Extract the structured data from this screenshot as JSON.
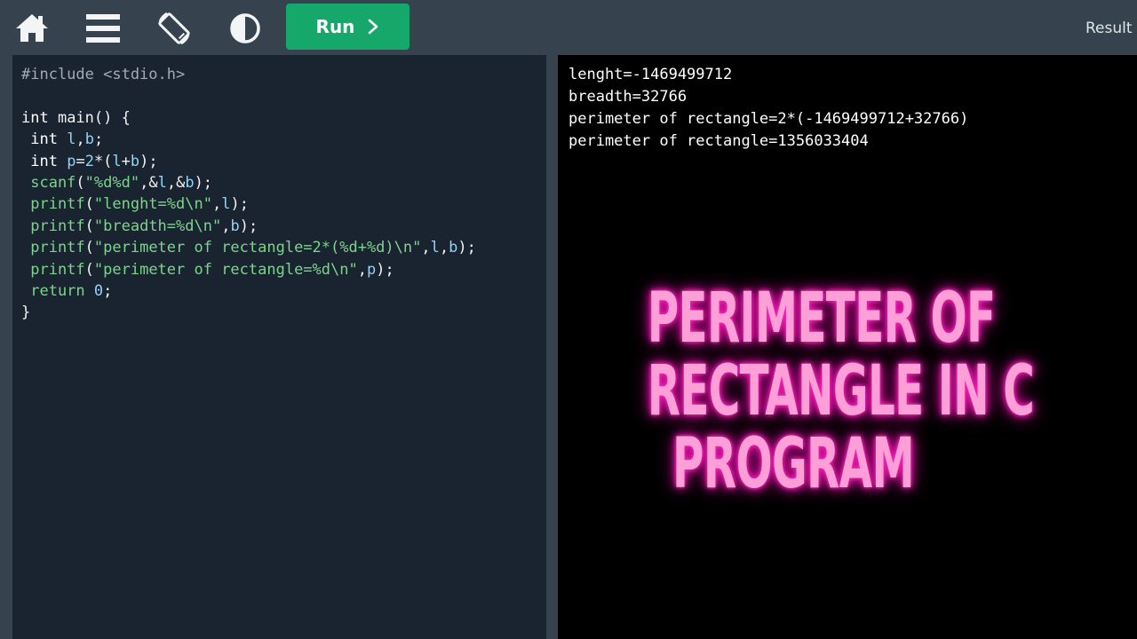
{
  "toolbar": {
    "icons": [
      "home-icon",
      "menu-icon",
      "rotate-screen-icon",
      "contrast-icon"
    ],
    "run_label": "Run",
    "result_label": "Result"
  },
  "editor": {
    "lines": [
      [
        {
          "t": "#include <stdio.h>",
          "c": "c-pre"
        }
      ],
      [],
      [
        {
          "t": "int ",
          "c": "c-kw"
        },
        {
          "t": "main() {",
          "c": "c-pl"
        }
      ],
      [
        {
          "t": " int ",
          "c": "c-kw"
        },
        {
          "t": "l",
          "c": "c-var"
        },
        {
          "t": ",",
          "c": "c-pl"
        },
        {
          "t": "b",
          "c": "c-var"
        },
        {
          "t": ";",
          "c": "c-pl"
        }
      ],
      [
        {
          "t": " int ",
          "c": "c-kw"
        },
        {
          "t": "p",
          "c": "c-var"
        },
        {
          "t": "=",
          "c": "c-pl"
        },
        {
          "t": "2",
          "c": "c-num"
        },
        {
          "t": "*(",
          "c": "c-pl"
        },
        {
          "t": "l",
          "c": "c-var"
        },
        {
          "t": "+",
          "c": "c-pl"
        },
        {
          "t": "b",
          "c": "c-var"
        },
        {
          "t": ");",
          "c": "c-pl"
        }
      ],
      [
        {
          "t": " scanf",
          "c": "c-fn"
        },
        {
          "t": "(",
          "c": "c-pl"
        },
        {
          "t": "\"%d%d\"",
          "c": "c-str"
        },
        {
          "t": ",&",
          "c": "c-pl"
        },
        {
          "t": "l",
          "c": "c-var"
        },
        {
          "t": ",&",
          "c": "c-pl"
        },
        {
          "t": "b",
          "c": "c-var"
        },
        {
          "t": ");",
          "c": "c-pl"
        }
      ],
      [
        {
          "t": " printf",
          "c": "c-fn"
        },
        {
          "t": "(",
          "c": "c-pl"
        },
        {
          "t": "\"lenght=%d\\n\"",
          "c": "c-str"
        },
        {
          "t": ",",
          "c": "c-pl"
        },
        {
          "t": "l",
          "c": "c-var"
        },
        {
          "t": ");",
          "c": "c-pl"
        }
      ],
      [
        {
          "t": " printf",
          "c": "c-fn"
        },
        {
          "t": "(",
          "c": "c-pl"
        },
        {
          "t": "\"breadth=%d\\n\"",
          "c": "c-str"
        },
        {
          "t": ",",
          "c": "c-pl"
        },
        {
          "t": "b",
          "c": "c-var"
        },
        {
          "t": ");",
          "c": "c-pl"
        }
      ],
      [
        {
          "t": " printf",
          "c": "c-fn"
        },
        {
          "t": "(",
          "c": "c-pl"
        },
        {
          "t": "\"perimeter of rectangle=2*(%d+%d)\\n\"",
          "c": "c-str"
        },
        {
          "t": ",",
          "c": "c-pl"
        },
        {
          "t": "l",
          "c": "c-var"
        },
        {
          "t": ",",
          "c": "c-pl"
        },
        {
          "t": "b",
          "c": "c-var"
        },
        {
          "t": ");",
          "c": "c-pl"
        }
      ],
      [
        {
          "t": " printf",
          "c": "c-fn"
        },
        {
          "t": "(",
          "c": "c-pl"
        },
        {
          "t": "\"perimeter of rectangle=%d\\n\"",
          "c": "c-str"
        },
        {
          "t": ",",
          "c": "c-pl"
        },
        {
          "t": "p",
          "c": "c-var"
        },
        {
          "t": ");",
          "c": "c-pl"
        }
      ],
      [
        {
          "t": " return ",
          "c": "c-fn"
        },
        {
          "t": "0",
          "c": "c-num"
        },
        {
          "t": ";",
          "c": "c-pl"
        }
      ],
      [
        {
          "t": "}",
          "c": "c-pl"
        }
      ]
    ]
  },
  "output": {
    "lines": [
      "lenght=-1469499712",
      "breadth=32766",
      "perimeter of rectangle=2*(-1469499712+32766)",
      "perimeter of rectangle=1356033404"
    ]
  },
  "overlay": {
    "lines": [
      "PERIMETER OF",
      "RECTANGLE IN C",
      "PROGRAM"
    ]
  },
  "colors": {
    "toolbar_bg": "#36434f",
    "run_button": "#16a86a",
    "editor_bg": "#1a2330",
    "output_bg": "#000000",
    "neon_text": "#ff9fd8",
    "neon_glow": "#ff1ab8"
  }
}
